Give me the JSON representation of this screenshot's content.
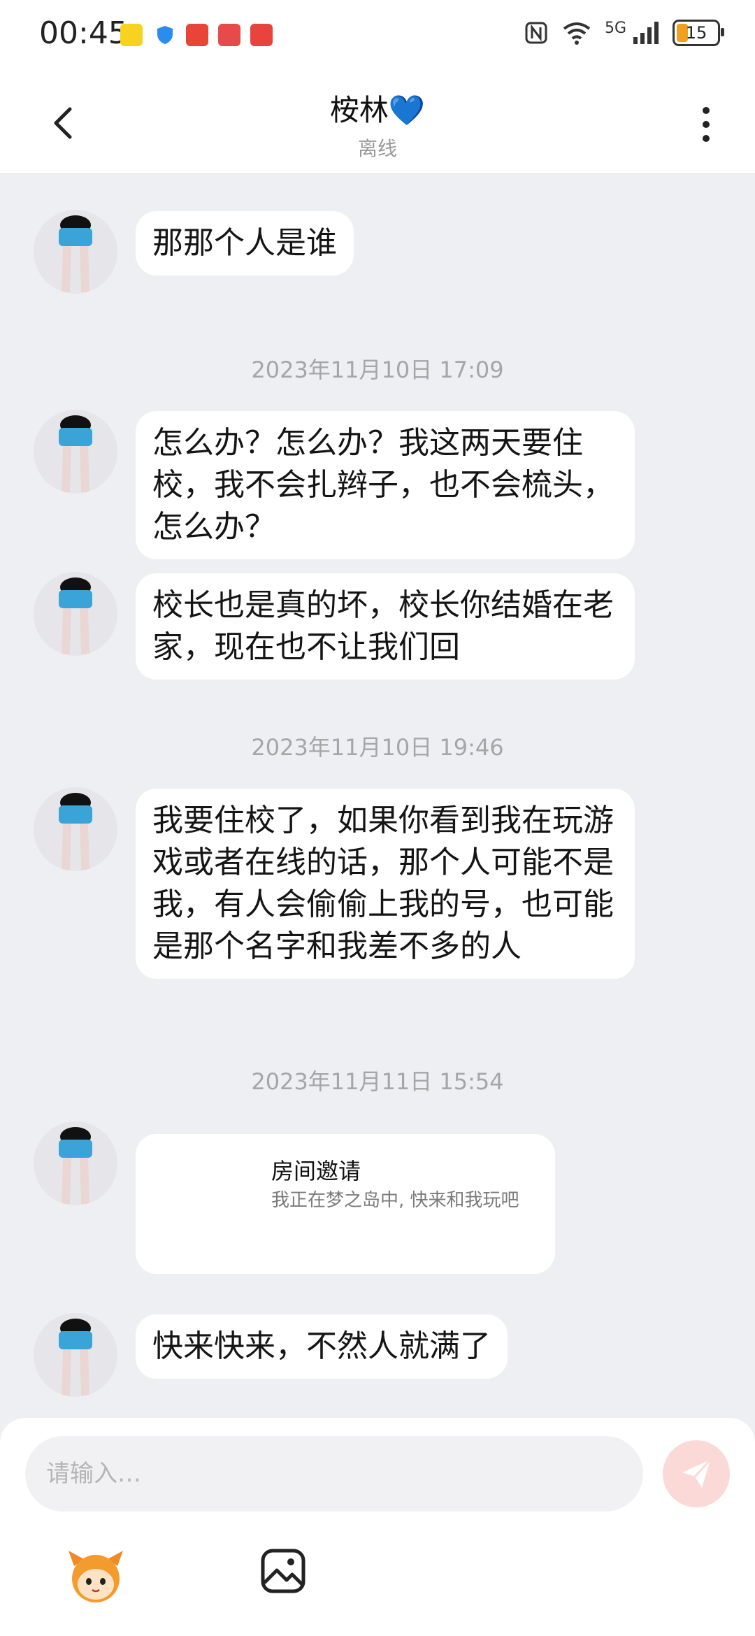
{
  "status_bar": {
    "time": "00:45",
    "battery": "15",
    "network": "5G"
  },
  "header": {
    "title": "桉林💙",
    "subtitle": "离线"
  },
  "messages": [
    {
      "type": "text",
      "text": "那那个人是谁"
    },
    {
      "type": "timestamp",
      "text": "2023年11月10日 17:09"
    },
    {
      "type": "text",
      "text": "怎么办？怎么办？我这两天要住校，我不会扎辫子，也不会梳头，怎么办？"
    },
    {
      "type": "text",
      "text": "校长也是真的坏，校长你结婚在老家，现在也不让我们回"
    },
    {
      "type": "timestamp",
      "text": "2023年11月10日 19:46"
    },
    {
      "type": "text",
      "text": "我要住校了，如果你看到我在玩游戏或者在线的话，那个人可能不是我，有人会偷偷上我的号，也可能是那个名字和我差不多的人"
    },
    {
      "type": "timestamp",
      "text": "2023年11月11日 15:54"
    },
    {
      "type": "invite",
      "title": "房间邀请",
      "desc": "我正在梦之岛中, 快来和我玩吧"
    },
    {
      "type": "text",
      "text": "快来快来，不然人就满了"
    }
  ],
  "composer": {
    "placeholder": "请输入…"
  },
  "icons": {
    "back": "back-arrow-icon",
    "more": "more-vertical-icon",
    "send": "send-icon",
    "emoji": "mascot-emoji-icon",
    "image": "image-icon"
  },
  "colors": {
    "background": "#eeeff3",
    "bubble": "#ffffff",
    "send_button": "#fbd9d6",
    "battery": "#f0a020"
  }
}
